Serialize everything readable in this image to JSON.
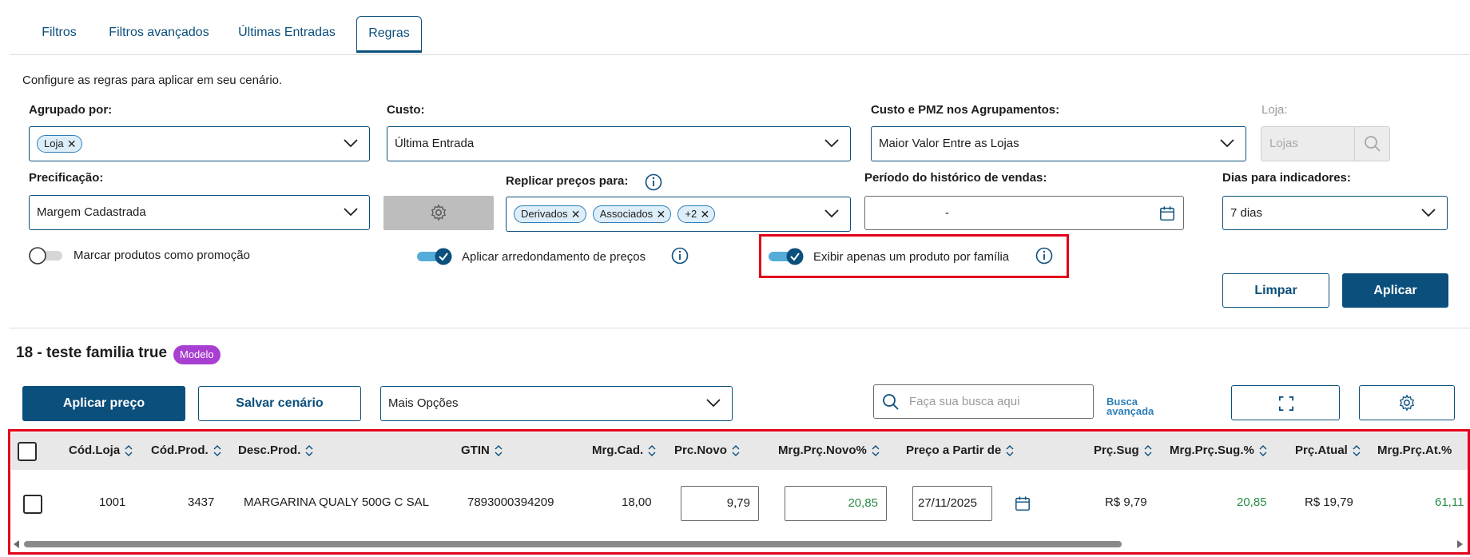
{
  "tabs": [
    {
      "label": "Filtros"
    },
    {
      "label": "Filtros avançados"
    },
    {
      "label": "Últimas Entradas"
    },
    {
      "label": "Regras"
    }
  ],
  "rules": {
    "intro": "Configure as regras para aplicar em seu cenário.",
    "agrupado_label": "Agrupado por:",
    "agrupado_chip": "Loja",
    "custo_label": "Custo:",
    "custo_value": "Última Entrada",
    "custo_pmz_label": "Custo e PMZ nos Agrupamentos:",
    "custo_pmz_value": "Maior Valor Entre as Lojas",
    "loja_label": "Loja:",
    "loja_placeholder": "Lojas",
    "precificacao_label": "Precificação:",
    "precificacao_value": "Margem Cadastrada",
    "replicar_label": "Replicar preços para:",
    "replicar_chips": [
      "Derivados",
      "Associados",
      "+2"
    ],
    "periodo_label": "Período do histórico de vendas:",
    "periodo_value": "-",
    "dias_label": "Dias para indicadores:",
    "dias_value": "7 dias",
    "toggle_promocao": "Marcar produtos como promoção",
    "toggle_promocao_on": false,
    "toggle_arredondamento": "Aplicar arredondamento de preços",
    "toggle_arredondamento_on": true,
    "toggle_familia": "Exibir apenas um produto por família",
    "toggle_familia_on": true,
    "limpar": "Limpar",
    "aplicar": "Aplicar"
  },
  "scenario": {
    "title": "18 - teste familia true",
    "badge": "Modelo",
    "badge_color": "#a93fd1",
    "aplicar_preco": "Aplicar preço",
    "salvar_cenario": "Salvar cenário",
    "mais_opcoes": "Mais Opções",
    "search_placeholder": "Faça sua busca aqui",
    "busca_avancada_1": "Busca",
    "busca_avancada_2": "avançada"
  },
  "table": {
    "headers": [
      "Cód.Loja",
      "Cód.Prod.",
      "Desc.Prod.",
      "GTIN",
      "Mrg.Cad.",
      "Prc.Novo",
      "Mrg.Prç.Novo%",
      "Preço a Partir de",
      "Prç.Sug",
      "Mrg.Prç.Sug.%",
      "Prç.Atual",
      "Mrg.Prç.At.%"
    ],
    "row": {
      "cod_loja": "1001",
      "cod_prod": "3437",
      "desc_prod": "MARGARINA QUALY 500G C SAL",
      "gtin": "7893000394209",
      "mrg_cad": "18,00",
      "prc_novo": "9,79",
      "mrg_prc_novo": "20,85",
      "preco_a_partir": "27/11/2025",
      "prc_sug": "R$ 9,79",
      "mrg_prc_sug": "20,85",
      "prc_atual": "R$ 19,79",
      "mrg_prc_at": "61,11"
    }
  },
  "colors": {
    "primary": "#0b4f7c",
    "highlight": "#e2001a",
    "positive": "#2a8c4a"
  }
}
